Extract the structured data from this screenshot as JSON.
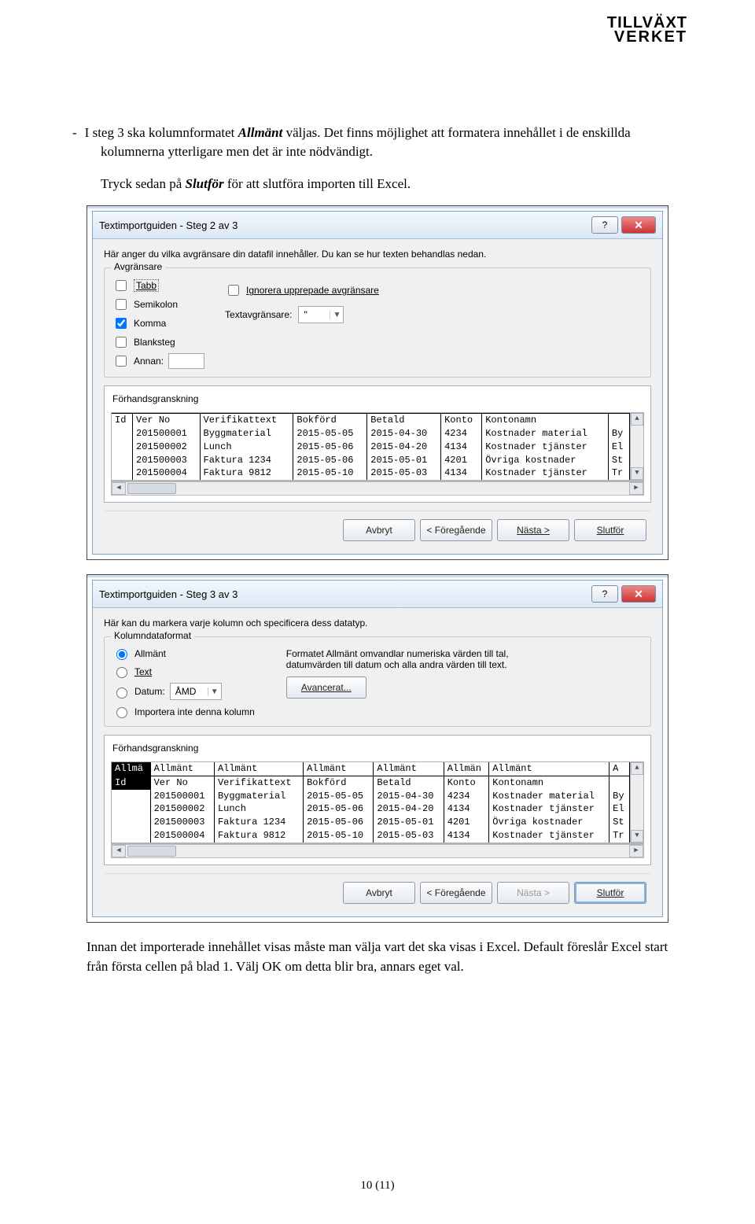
{
  "logo": {
    "line1a": "TILLVÄ",
    "line1b": "XT",
    "line2a": "VERKE",
    "line2b": "T"
  },
  "para1a": "I steg 3 ska kolumnformatet ",
  "para1b": "Allmänt",
  "para1c": " väljas. Det finns möjlighet att formatera innehållet i de enskillda kolumnerna ytterligare men det är inte nödvändigt.",
  "para1d": "Tryck sedan på ",
  "para1e": "Slutför",
  "para1f": " för att slutföra importen till Excel.",
  "dialog1": {
    "title": "Textimportguiden - Steg 2 av 3",
    "intro": "Här anger du vilka avgränsare din datafil innehåller. Du kan se hur texten behandlas nedan.",
    "group_delim": "Avgränsare",
    "delims": {
      "tabb": "Tabb",
      "semikolon": "Semikolon",
      "komma": "Komma",
      "blanksteg": "Blanksteg",
      "annan": "Annan:"
    },
    "ignore_repeat": "Ignorera upprepade avgränsare",
    "text_qual_label": "Textavgränsare:",
    "text_qual_value": "\"",
    "preview_title": "Förhandsgranskning",
    "buttons": {
      "cancel": "Avbryt",
      "back": "< Föregående",
      "next": "Nästa >",
      "finish": "Slutför"
    }
  },
  "dialog2": {
    "title": "Textimportguiden - Steg 3 av 3",
    "intro": "Här kan du markera varje kolumn och specificera dess datatyp.",
    "group_fmt": "Kolumndataformat",
    "formats": {
      "allmant": "Allmänt",
      "text": "Text",
      "datum": "Datum:",
      "skip": "Importera inte denna kolumn"
    },
    "date_fmt": "ÅMD",
    "fmt_note": "Formatet Allmänt omvandlar numeriska värden till tal, datumvärden till datum och alla andra värden till text.",
    "adv_btn": "Avancerat...",
    "preview_title": "Förhandsgranskning",
    "buttons": {
      "cancel": "Avbryt",
      "back": "< Föregående",
      "next": "Nästa >",
      "finish": "Slutför"
    }
  },
  "preview": {
    "headers": [
      "Id",
      "Ver No",
      "Verifikattext",
      "Bokförd",
      "Betald",
      "Konto",
      "Kontonamn",
      ""
    ],
    "formats": [
      "Allmä",
      "Allmänt",
      "Allmänt",
      "Allmänt",
      "Allmänt",
      "Allmän",
      "Allmänt",
      "A"
    ],
    "rows": [
      [
        "",
        "201500001",
        "Byggmaterial",
        "2015-05-05",
        "2015-04-30",
        "4234",
        "Kostnader material",
        "By"
      ],
      [
        "",
        "201500002",
        "Lunch",
        "2015-05-06",
        "2015-04-20",
        "4134",
        "Kostnader tjänster",
        "El"
      ],
      [
        "",
        "201500003",
        "Faktura 1234",
        "2015-05-06",
        "2015-05-01",
        "4201",
        "Övriga kostnader",
        "St"
      ],
      [
        "",
        "201500004",
        "Faktura 9812",
        "2015-05-10",
        "2015-05-03",
        "4134",
        "Kostnader tjänster",
        "Tr"
      ]
    ]
  },
  "para2": "Innan det importerade innehållet visas måste man välja vart det ska visas i Excel. Default föreslår Excel start från första cellen på blad 1. Välj OK om detta blir bra, annars eget val.",
  "page_num": "10 (11)"
}
